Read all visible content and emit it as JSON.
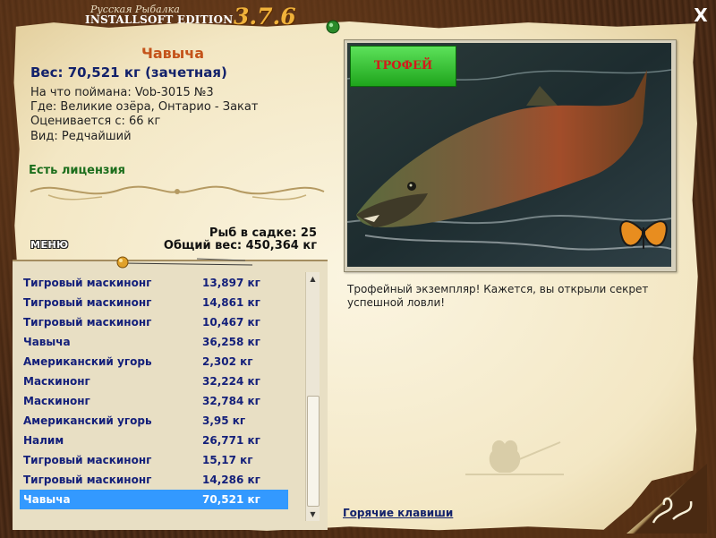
{
  "app": {
    "title_ru": "Русская Рыбалка",
    "edition": "INSTALLSOFT EDITION",
    "version": "3.7.6",
    "close_label": "X"
  },
  "fish": {
    "name": "Чавыча",
    "weight_line": "Вес: 70,521 кг (зачетная)",
    "bait": "На что поймана: Vob-3015 №3",
    "location": "Где: Великие озёра, Онтарио - Закат",
    "price": "Оценивается с: 66 кг",
    "rarity": "Вид: Редчайший",
    "license": "Есть лицензия"
  },
  "totals": {
    "count": "Рыб в садке: 25",
    "total_weight": "Общий вес: 450,364 кг"
  },
  "menu_label": "МЕНЮ",
  "catch_list": [
    {
      "name": "Тигровый маскинонг",
      "weight": "13,897 кг"
    },
    {
      "name": "Тигровый маскинонг",
      "weight": "14,861 кг"
    },
    {
      "name": "Тигровый маскинонг",
      "weight": "10,467 кг"
    },
    {
      "name": "Чавыча",
      "weight": "36,258 кг"
    },
    {
      "name": "Американский угорь",
      "weight": "2,302 кг"
    },
    {
      "name": "Маскинонг",
      "weight": "32,224 кг"
    },
    {
      "name": "Маскинонг",
      "weight": "32,784 кг"
    },
    {
      "name": "Американский угорь",
      "weight": "3,95 кг"
    },
    {
      "name": "Налим",
      "weight": "26,771 кг"
    },
    {
      "name": "Тигровый маскинонг",
      "weight": "15,17 кг"
    },
    {
      "name": "Тигровый маскинонг",
      "weight": "14,286 кг"
    },
    {
      "name": "Чавыча",
      "weight": "70,521 кг",
      "selected": true
    }
  ],
  "trophy_badge": "ТРОФЕЙ",
  "message": "Трофейный экземпляр! Кажется, вы открыли секрет успешной ловли!",
  "hotkeys_link": "Горячие клавиши",
  "colors": {
    "fish_name": "#c4531a",
    "list_text": "#14207a",
    "selection": "#3399ff",
    "license": "#1c6e1c",
    "version": "#f0b23a"
  }
}
